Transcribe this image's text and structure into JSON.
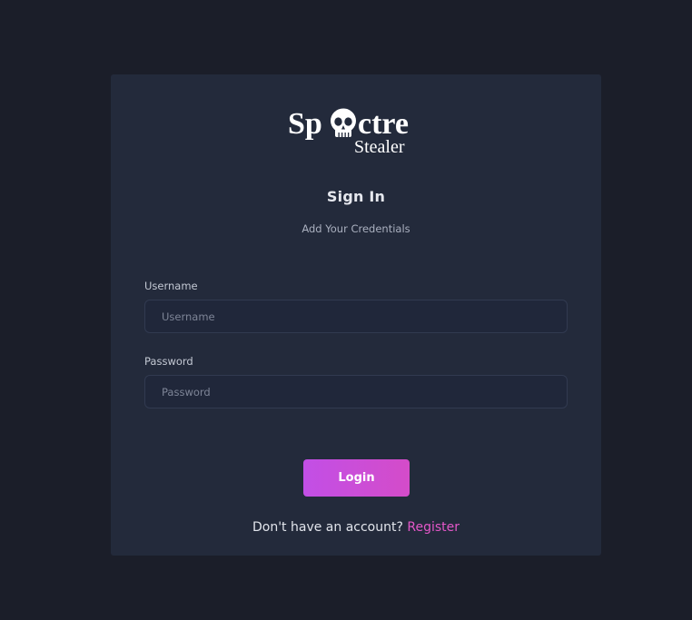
{
  "logo": {
    "word_left": "Sp",
    "word_right": "ctre",
    "tagline": "Stealer",
    "icon": "skull-icon"
  },
  "heading": {
    "title": "Sign In",
    "subtitle": "Add Your Credentials"
  },
  "form": {
    "username_label": "Username",
    "username_placeholder": "Username",
    "username_value": "",
    "password_label": "Password",
    "password_placeholder": "Password",
    "password_value": ""
  },
  "actions": {
    "login_label": "Login",
    "register_prompt": "Don't have an account? ",
    "register_link": "Register"
  },
  "colors": {
    "page_background": "#1b1e29",
    "card_background": "#232a3b",
    "accent_start": "#c24fe6",
    "accent_end": "#d44cc9",
    "link": "#e357c8"
  }
}
